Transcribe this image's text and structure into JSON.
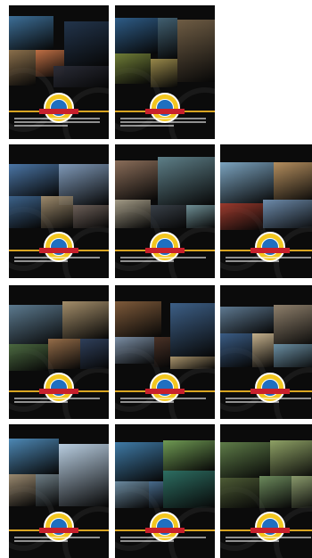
{
  "cards": [
    {
      "id": "card-1",
      "photos": [
        "#3d6f98",
        "#22344b",
        "#8a6f4b",
        "#bf6f44",
        "#2a2c37"
      ],
      "caption_lines": 3
    },
    {
      "id": "card-2",
      "photos": [
        "#2e5c87",
        "#6e5c44",
        "#6f7d37",
        "#98884a",
        "#415f70"
      ],
      "caption_lines": 3
    },
    {
      "id": "card-3",
      "photos": [
        "#4b76a6",
        "#7f99b8",
        "#3c628a",
        "#9d8a6c",
        "#6c5f58"
      ],
      "caption_lines": 2
    },
    {
      "id": "card-4",
      "photos": [
        "#8a6d59",
        "#5e7f88",
        "#a39b86",
        "#394048",
        "#6f8f95"
      ],
      "caption_lines": 2
    },
    {
      "id": "card-5",
      "photos": [
        "#7ba3bf",
        "#b48e5e",
        "#9c3a2d",
        "#6d8bab",
        "#556074"
      ],
      "caption_lines": 2
    },
    {
      "id": "card-6",
      "photos": [
        "#5c7a8f",
        "#a48e6a",
        "#4b6940",
        "#946c48",
        "#2f3f5a"
      ],
      "caption_lines": 2
    },
    {
      "id": "card-7",
      "photos": [
        "#7e5a3a",
        "#3d5f86",
        "#7b8ea4",
        "#4a3227",
        "#a8936c"
      ],
      "caption_lines": 2
    },
    {
      "id": "card-8",
      "photos": [
        "#5e7991",
        "#8e7f6b",
        "#3a5c85",
        "#c4b08c",
        "#6b8fa3"
      ],
      "caption_lines": 2
    },
    {
      "id": "card-9",
      "photos": [
        "#4d88b5",
        "#b8cde0",
        "#9b8a70",
        "#6e7e86",
        "#3f5f82"
      ],
      "caption_lines": 2
    },
    {
      "id": "card-10",
      "photos": [
        "#3f7aa6",
        "#6f9a53",
        "#6b8aa0",
        "#2d6e62",
        "#486b8c"
      ],
      "caption_lines": 2
    },
    {
      "id": "card-11",
      "photos": [
        "#5e7c48",
        "#8ea165",
        "#4d5b35",
        "#6c8a5c",
        "#8a9a6c"
      ],
      "caption_lines": 2
    }
  ]
}
